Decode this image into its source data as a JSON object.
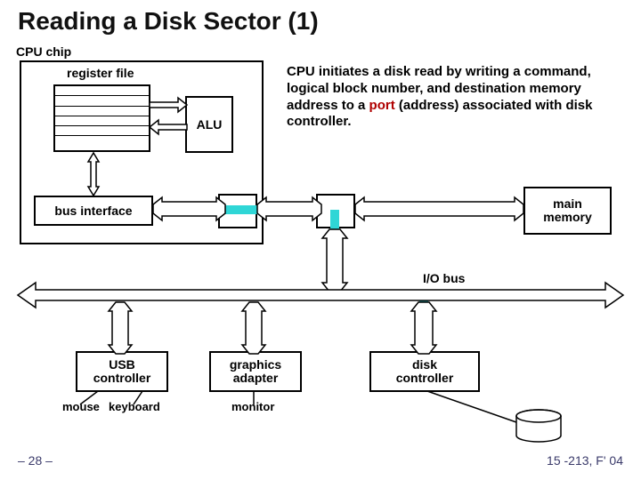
{
  "title": "Reading a Disk Sector (1)",
  "cpu_chip_label": "CPU chip",
  "register_file_label": "register file",
  "alu_label": "ALU",
  "bus_interface_label": "bus interface",
  "main_memory_label": "main\nmemory",
  "description_pre": "CPU initiates a disk read by writing a command, logical block number, and destination memory address to a ",
  "description_port": "port",
  "description_post": " (address) associated with disk controller.",
  "io_bus_label": "I/O bus",
  "controllers": {
    "usb": "USB\ncontroller",
    "graphics": "graphics\nadapter",
    "disk": "disk\ncontroller"
  },
  "peripherals": {
    "mouse": "mouse",
    "keyboard": "keyboard",
    "monitor": "monitor",
    "disk": "disk"
  },
  "footer": {
    "page": "– 28 –",
    "course": "15 -213, F' 04"
  },
  "colors": {
    "highlight_path": "#2fd6d6",
    "port_red": "#b00000"
  }
}
